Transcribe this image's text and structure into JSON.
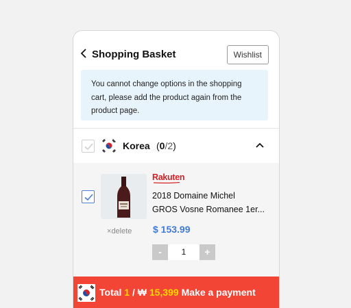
{
  "header": {
    "title": "Shopping Basket",
    "wishlist_label": "Wishlist"
  },
  "notice": {
    "text": "You cannot change options in the shopping cart, please add the product again from the product page."
  },
  "group": {
    "name": "Korea",
    "count_open": "(",
    "count_selected": "0",
    "count_total": "/2",
    "count_close": ")",
    "checked": false
  },
  "item": {
    "checked": true,
    "store": "Rakuten",
    "name_line1": "2018 Domaine Michel",
    "name_line2": "GROS Vosne Romanee 1er...",
    "price": "$ 153.99",
    "quantity": "1",
    "minus_label": "-",
    "plus_label": "+",
    "delete_label": "delete",
    "delete_symbol": "×"
  },
  "payment": {
    "total_label": "Total",
    "total_count": "1",
    "separator": "/",
    "currency": "₩",
    "amount": "15,399",
    "action_label": "Make a payment"
  },
  "colors": {
    "accent_blue": "#3f7ad6",
    "pay_red": "#f24536",
    "highlight_yellow": "#ffd800",
    "notice_bg": "#e8f4fb"
  }
}
